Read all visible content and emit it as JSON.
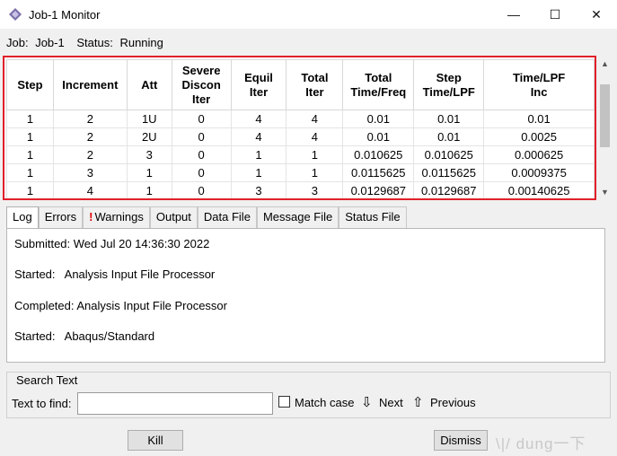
{
  "window": {
    "title": "Job-1 Monitor",
    "minimize": "—",
    "maximize": "☐",
    "close": "✕"
  },
  "job": {
    "job_label": "Job:",
    "job_value": "Job-1",
    "status_label": "Status:",
    "status_value": "Running"
  },
  "table": {
    "headers": [
      [
        "Step"
      ],
      [
        "Increment"
      ],
      [
        "Att"
      ],
      [
        "Severe",
        "Discon",
        "Iter"
      ],
      [
        "Equil",
        "Iter"
      ],
      [
        "Total",
        "Iter"
      ],
      [
        "Total",
        "Time/Freq"
      ],
      [
        "Step",
        "Time/LPF"
      ],
      [
        "Time/LPF",
        "Inc"
      ]
    ],
    "rows": [
      [
        "1",
        "2",
        "1U",
        "0",
        "4",
        "4",
        "0.01",
        "0.01",
        "0.01"
      ],
      [
        "1",
        "2",
        "2U",
        "0",
        "4",
        "4",
        "0.01",
        "0.01",
        "0.0025"
      ],
      [
        "1",
        "2",
        "3",
        "0",
        "1",
        "1",
        "0.010625",
        "0.010625",
        "0.000625"
      ],
      [
        "1",
        "3",
        "1",
        "0",
        "1",
        "1",
        "0.0115625",
        "0.0115625",
        "0.0009375"
      ],
      [
        "1",
        "4",
        "1",
        "0",
        "3",
        "3",
        "0.0129687",
        "0.0129687",
        "0.00140625"
      ]
    ]
  },
  "tabs": [
    {
      "label": "Log",
      "active": true
    },
    {
      "label": "Errors"
    },
    {
      "label": "Warnings",
      "warning": true
    },
    {
      "label": "Output"
    },
    {
      "label": "Data File"
    },
    {
      "label": "Message File"
    },
    {
      "label": "Status File"
    }
  ],
  "warning_mark": "!",
  "log": [
    "Submitted: Wed Jul 20 14:36:30 2022",
    "Started:   Analysis Input File Processor",
    "Completed: Analysis Input File Processor",
    "Started:   Abaqus/Standard"
  ],
  "search": {
    "group_label": "Search Text",
    "find_label": "Text to find:",
    "find_value": "",
    "match_case_label": "Match case",
    "match_case_checked": false,
    "next_label": "Next",
    "previous_label": "Previous"
  },
  "buttons": {
    "kill": "Kill",
    "dismiss": "Dismiss"
  },
  "watermark": "\\|/  dung一下",
  "colors": {
    "highlight_border": "#e0202a",
    "warning_mark": "#e00000"
  }
}
